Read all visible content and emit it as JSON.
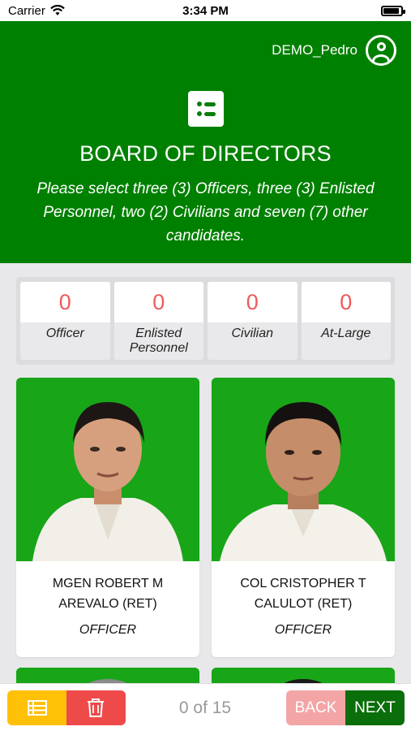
{
  "status_bar": {
    "carrier": "Carrier",
    "time": "3:34 PM",
    "icons": [
      "wifi-icon",
      "battery-icon"
    ]
  },
  "header": {
    "username": "DEMO_Pedro",
    "title": "BOARD OF DIRECTORS",
    "subtitle": "Please select three (3) Officers, three (3) Enlisted Personnel, two (2) Civilians and seven (7) other candidates.",
    "background_color": "#008000",
    "icons": [
      "user-icon",
      "list-icon"
    ]
  },
  "counters": [
    {
      "value": "0",
      "label": "Officer"
    },
    {
      "value": "0",
      "label": "Enlisted Personnel"
    },
    {
      "value": "0",
      "label": "Civilian"
    },
    {
      "value": "0",
      "label": "At-Large"
    }
  ],
  "candidates": [
    {
      "name": "MGEN ROBERT M AREVALO (RET)",
      "role": "OFFICER"
    },
    {
      "name": "COL CRISTOPHER T CALULOT (RET)",
      "role": "OFFICER"
    }
  ],
  "bottom_bar": {
    "page_count": "0 of 15",
    "back_label": "BACK",
    "next_label": "NEXT",
    "icons": [
      "list-icon",
      "trash-icon"
    ],
    "colors": {
      "list": "#ffc107",
      "delete": "#ef4a4a",
      "back": "#f3a5a5",
      "next": "#0a6e0a"
    }
  }
}
